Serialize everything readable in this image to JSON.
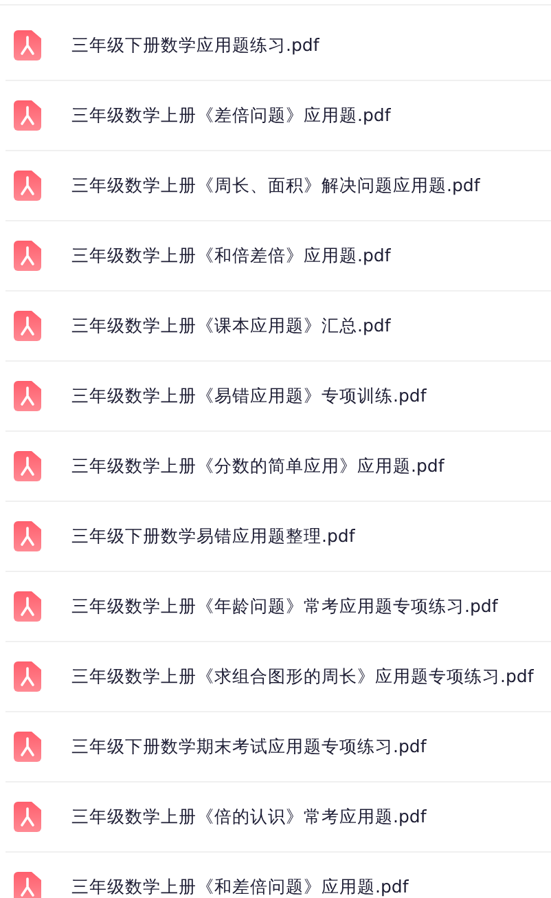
{
  "files": [
    {
      "name": "三年级下册数学应用题练习.pdf"
    },
    {
      "name": "三年级数学上册《差倍问题》应用题.pdf"
    },
    {
      "name": "三年级数学上册《周长、面积》解决问题应用题.pdf"
    },
    {
      "name": "三年级数学上册《和倍差倍》应用题.pdf"
    },
    {
      "name": "三年级数学上册《课本应用题》汇总.pdf"
    },
    {
      "name": "三年级数学上册《易错应用题》专项训练.pdf"
    },
    {
      "name": "三年级数学上册《分数的简单应用》应用题.pdf"
    },
    {
      "name": "三年级下册数学易错应用题整理.pdf"
    },
    {
      "name": "三年级数学上册《年龄问题》常考应用题专项练习.pdf"
    },
    {
      "name": "三年级数学上册《求组合图形的周长》应用题专项练习.pdf"
    },
    {
      "name": "三年级下册数学期末考试应用题专项练习.pdf"
    },
    {
      "name": "三年级数学上册《倍的认识》常考应用题.pdf"
    },
    {
      "name": "三年级数学上册《和差倍问题》应用题.pdf"
    }
  ]
}
